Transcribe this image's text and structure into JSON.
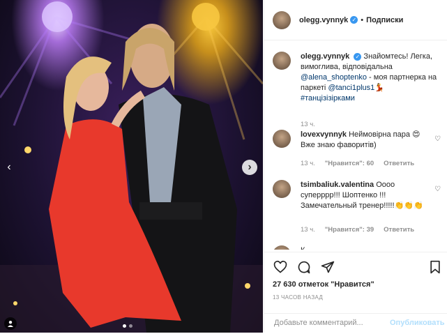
{
  "post": {
    "author": "olegg.vynnyk",
    "follow_label": "Подписки",
    "separator": "•"
  },
  "caption": {
    "author": "olegg.vynnyk",
    "text_1": "Знайомтесь! Легка, вимоглива, відповідальна",
    "mention_1": "@alena_shoptenko",
    "text_2": "- моя партнерка на паркеті",
    "mention_2": "@tanci1plus1",
    "emoji": "💃",
    "hashtag": "#танцізізірками",
    "time": "13 ч."
  },
  "comments": [
    {
      "author": "lovexvynnyk",
      "text": "Неймовірна пара 😍 Вже знаю фаворитів)",
      "time": "13 ч.",
      "likes": "\"Нравится\": 60",
      "reply": "Ответить"
    },
    {
      "author": "tsimbaliuk.valentina",
      "text": "Оооо суперррр!!! Шоптенко !!! Замечательный тренер!!!!!👏👏👏",
      "time": "13 ч.",
      "likes": "\"Нравится\": 39",
      "reply": "Ответить"
    },
    {
      "author": "",
      "text": "К",
      "time": "",
      "likes": "",
      "reply": ""
    }
  ],
  "actions": {
    "likes_text": "27 630 отметок \"Нравится\"",
    "timestamp": "13 ЧАСОВ НАЗАД",
    "comment_placeholder": "Добавьте комментарий...",
    "publish_label": "Опубликовать"
  },
  "photo": {
    "slide_count": 2,
    "active_slide": 1
  },
  "colors": {
    "verified": "#3897f0",
    "link": "#00376b",
    "muted": "#8e8e8e",
    "publish_disabled": "#b2dffc"
  }
}
